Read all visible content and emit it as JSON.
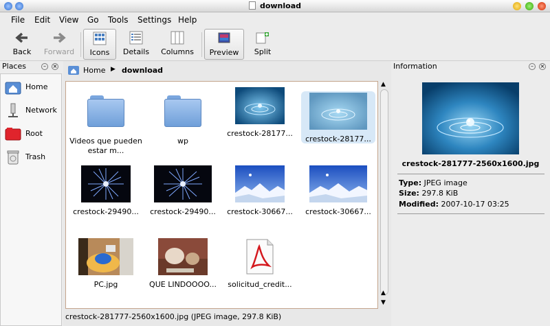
{
  "window": {
    "title": "download"
  },
  "menu": [
    "File",
    "Edit",
    "View",
    "Go",
    "Tools",
    "Settings",
    "Help"
  ],
  "toolbar": {
    "back": "Back",
    "forward": "Forward",
    "icons": "Icons",
    "details": "Details",
    "columns": "Columns",
    "preview": "Preview",
    "split": "Split"
  },
  "places": {
    "title": "Places",
    "items": [
      {
        "label": "Home",
        "icon": "home-icon"
      },
      {
        "label": "Network",
        "icon": "network-icon"
      },
      {
        "label": "Root",
        "icon": "root-folder-icon"
      },
      {
        "label": "Trash",
        "icon": "trash-icon"
      }
    ]
  },
  "breadcrumb": {
    "home": "Home",
    "current": "download"
  },
  "files": [
    {
      "name": "Videos que pueden estar m...",
      "kind": "folder"
    },
    {
      "name": "wp",
      "kind": "folder"
    },
    {
      "name": "crestock-28177...",
      "kind": "water"
    },
    {
      "name": "crestock-28177...",
      "kind": "water",
      "selected": true
    },
    {
      "name": "crestock-29490...",
      "kind": "firework"
    },
    {
      "name": "crestock-29490...",
      "kind": "firework"
    },
    {
      "name": "crestock-30667...",
      "kind": "mountain"
    },
    {
      "name": "crestock-30667...",
      "kind": "mountain"
    },
    {
      "name": "PC.jpg",
      "kind": "photo-pc"
    },
    {
      "name": "QUE LINDOOOO...",
      "kind": "photo-dog"
    },
    {
      "name": "solicitud_credit...",
      "kind": "pdf"
    }
  ],
  "status": "crestock-281777-2560x1600.jpg (JPEG image, 297.8 KiB)",
  "info": {
    "title": "Information",
    "filename": "crestock-281777-2560x1600.jpg",
    "type_label": "Type:",
    "type_value": "JPEG image",
    "size_label": "Size:",
    "size_value": "297.8 KiB",
    "modified_label": "Modified:",
    "modified_value": "2007-10-17 03:25"
  },
  "colors": {
    "selection": "#d7e8f7",
    "folder": "#8fb5e8",
    "accent_border": "#c4a48c"
  }
}
